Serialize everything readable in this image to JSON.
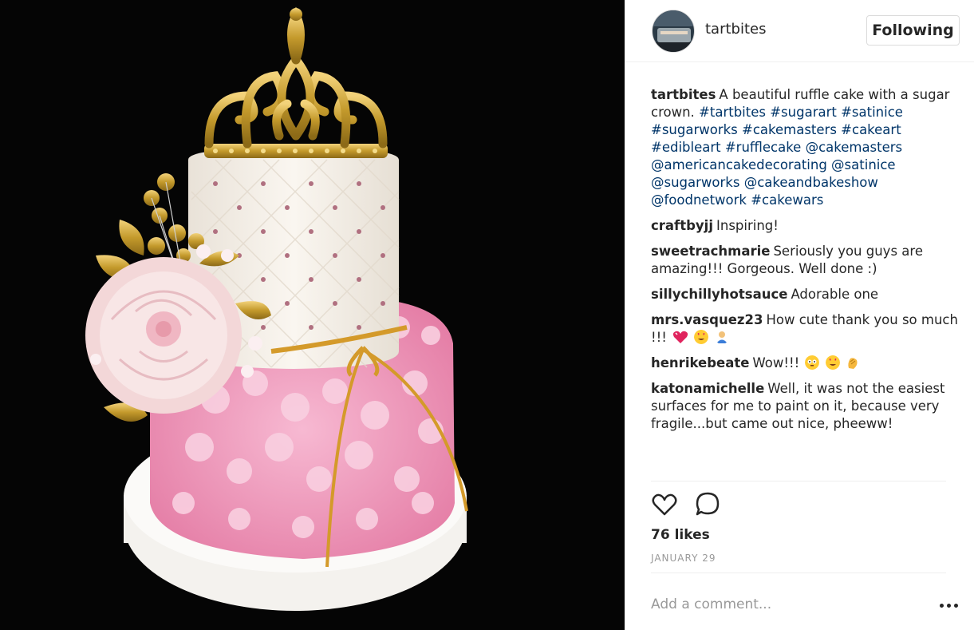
{
  "post": {
    "username": "tartbites",
    "follow_label": "Following"
  },
  "caption": {
    "user": "tartbites",
    "text": "A beautiful ruffle cake with a sugar crown.",
    "tags": "#tartbites #sugarart #satinice #sugarworks #cakemasters #cakeart #edibleart #rufflecake @cakemasters @americancakedecorating @satinice @sugarworks @cakeandbakeshow @foodnetwork #cakewars"
  },
  "comments": [
    {
      "user": "craftbyjj",
      "text": "Inspiring!"
    },
    {
      "user": "sweetrachmarie",
      "text": "Seriously you guys are amazing!!! Gorgeous. Well done :)"
    },
    {
      "user": "sillychillyhotsauce",
      "text": "Adorable one"
    },
    {
      "user": "mrs.vasquez23",
      "text": "How cute thank you so much !!!"
    },
    {
      "user": "henrikebeate",
      "text": "Wow!!!"
    },
    {
      "user": "katonamichelle",
      "text": "Well, it was not the easiest surfaces for me to paint on it, because very fragile...but came out nice, pheeww!"
    }
  ],
  "icons": {
    "like": "heart-outline-icon",
    "comment": "speech-bubble-icon",
    "more": "ellipsis-icon"
  },
  "likes_label": "76 likes",
  "date_label": "JANUARY 29",
  "comment_input": {
    "placeholder": "Add a comment..."
  },
  "colors": {
    "tag": "#003569",
    "text": "#262626",
    "muted": "#999999",
    "gold": "#c9a23a",
    "pink": "#f2a7c4"
  }
}
